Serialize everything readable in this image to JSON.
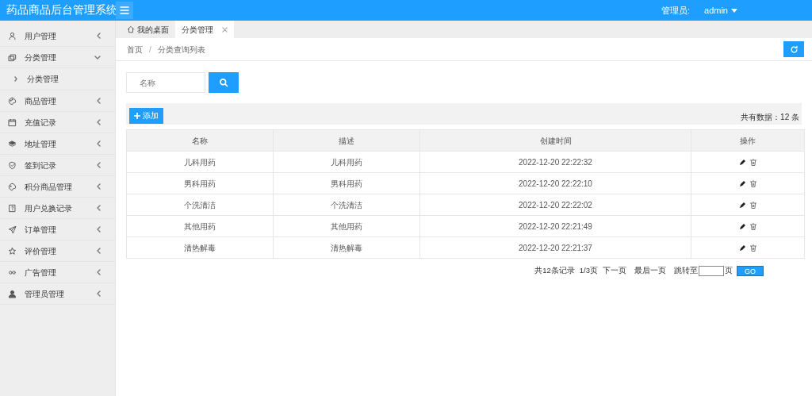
{
  "header": {
    "title": "药品商品后台管理系统",
    "user_label": "管理员:",
    "user_name": "admin"
  },
  "sidebar": {
    "items": [
      {
        "label": "用户管理",
        "expanded": false
      },
      {
        "label": "分类管理",
        "expanded": true,
        "children": [
          {
            "label": "分类管理"
          }
        ]
      },
      {
        "label": "商品管理",
        "expanded": false
      },
      {
        "label": "充值记录",
        "expanded": false
      },
      {
        "label": "地址管理",
        "expanded": false
      },
      {
        "label": "签到记录",
        "expanded": false
      },
      {
        "label": "积分商品管理",
        "expanded": false
      },
      {
        "label": "用户兑换记录",
        "expanded": false
      },
      {
        "label": "订单管理",
        "expanded": false
      },
      {
        "label": "评价管理",
        "expanded": false
      },
      {
        "label": "广告管理",
        "expanded": false
      },
      {
        "label": "管理员管理",
        "expanded": false
      }
    ]
  },
  "tabs": [
    {
      "label": "我的桌面",
      "selected": false,
      "closable": false
    },
    {
      "label": "分类管理",
      "selected": true,
      "closable": true
    }
  ],
  "breadcrumb": {
    "items": [
      "首页",
      "分类查询列表"
    ],
    "separator": "/"
  },
  "search": {
    "placeholder": "名称"
  },
  "toolbar": {
    "add_label": "添加",
    "total": "共有数据：12 条"
  },
  "table": {
    "columns": [
      "名称",
      "描述",
      "创建时间",
      "操作"
    ],
    "rows": [
      {
        "name": "儿科用药",
        "description": "儿科用药",
        "created": "2022-12-20 22:22:32"
      },
      {
        "name": "男科用药",
        "description": "男科用药",
        "created": "2022-12-20 22:22:10"
      },
      {
        "name": "个洗清洁",
        "description": "个洗清洁",
        "created": "2022-12-20 22:22:02"
      },
      {
        "name": "其他用药",
        "description": "其他用药",
        "created": "2022-12-20 22:21:49"
      },
      {
        "name": "清热解毒",
        "description": "清热解毒",
        "created": "2022-12-20 22:21:37"
      }
    ]
  },
  "pagination": {
    "records": "共12条记录",
    "pages": "1/3页",
    "next": "下一页",
    "last": "最后一页",
    "jump_label": "跳转至",
    "page_unit": "页",
    "go": "GO"
  }
}
